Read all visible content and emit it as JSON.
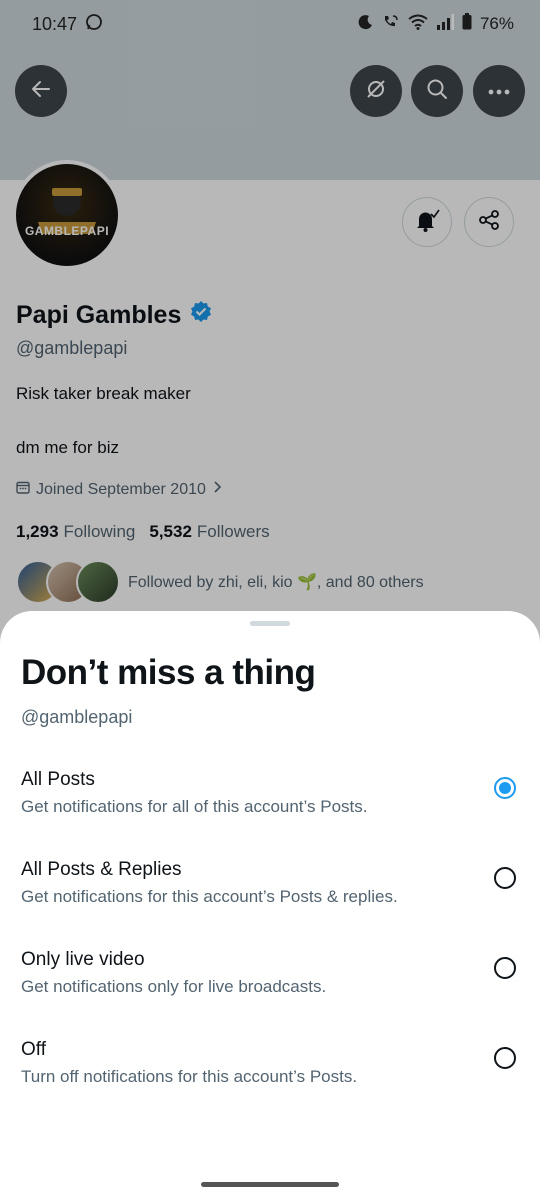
{
  "status_bar": {
    "time": "10:47",
    "battery": "76%",
    "icons": [
      "whatsapp-icon",
      "moon-icon",
      "wifi-call-icon",
      "wifi-icon",
      "signal-icon",
      "battery-icon"
    ]
  },
  "profile": {
    "avatar_text": "GAMBLEPAPI",
    "name": "Papi Gambles",
    "handle": "@gamblepapi",
    "bio_line1": "Risk taker break maker",
    "bio_line2": "dm me for biz",
    "joined": "Joined September 2010",
    "following_count": "1,293",
    "following_label": "Following",
    "followers_count": "5,532",
    "followers_label": "Followers",
    "followed_by": "Followed by zhi, eli, kio 🌱, and 80 others"
  },
  "sheet": {
    "title": "Don’t miss a thing",
    "handle": "@gamblepapi",
    "selected_index": 0,
    "options": [
      {
        "label": "All Posts",
        "description": "Get notifications for all of this account’s Posts."
      },
      {
        "label": "All Posts & Replies",
        "description": "Get notifications for this account’s Posts & replies."
      },
      {
        "label": "Only live video",
        "description": "Get notifications only for live broadcasts."
      },
      {
        "label": "Off",
        "description": "Turn off notifications for this account’s Posts."
      }
    ]
  },
  "colors": {
    "accent": "#1d9bf0",
    "banner": "#cfd9de",
    "secondary_text": "#536471"
  }
}
